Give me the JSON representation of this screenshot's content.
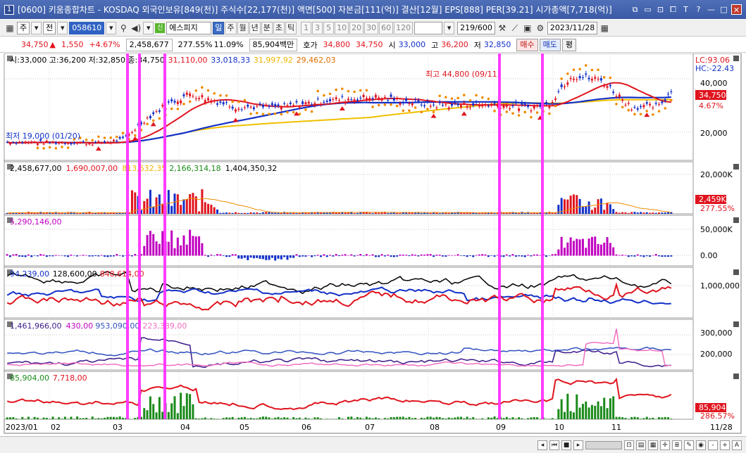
{
  "window": {
    "number": "1",
    "title": "[0600] 키움종합차트 - KOSDAQ 외국인보유[849(천)] 주식수[22,177(천)] 액면[500] 자본금[111(억)] 결산[12월] EPS[888] PER[39.21] 시가총액[7,718(억)]",
    "icons": [
      "link-icon",
      "frame-icon",
      "lock-icon",
      "restore-icon",
      "font-T-icon",
      "help-icon",
      "minimize-icon",
      "maximize-icon",
      "close-icon"
    ],
    "icon_glyphs": [
      "⧉",
      "▭",
      "⊡",
      "⧠",
      "T",
      "?",
      "—",
      "□",
      "✕"
    ]
  },
  "toolbar": {
    "period_sel": "주",
    "prev_btn": "전",
    "code": "058610",
    "stock_name": "에스피지",
    "periods": [
      "일",
      "주",
      "월",
      "년",
      "분",
      "초",
      "틱"
    ],
    "active_period": "일",
    "intervals": [
      "1",
      "3",
      "5",
      "10",
      "20",
      "30",
      "60",
      "120"
    ],
    "count": "219/600",
    "date": "2023/11/28",
    "green_label": "신"
  },
  "quote": {
    "price": "34,750",
    "arrow": "▲",
    "change": "1,550",
    "change_pct": "+4.67%",
    "volume": "2,458,677",
    "vol_ratio": "277.55%",
    "turnover": "11.09%",
    "amount": "85,904백만",
    "hoga_label": "호가",
    "ask": "34,800",
    "bid": "34,750",
    "open_label": "시",
    "open": "33,000",
    "high_label": "고",
    "high": "36,200",
    "low_label": "저",
    "low": "32,850",
    "buy": "매수",
    "sell": "매도",
    "flat": "평"
  },
  "panels": {
    "price": {
      "legend": [
        {
          "text": "시:33,000 고:36,200 저:32,850 종:34,750",
          "color": "#000000"
        },
        {
          "text": "31,110,00",
          "color": "#e0141e"
        },
        {
          "text": "33,018,33",
          "color": "#1230c8"
        },
        {
          "text": "31,997,92",
          "color": "#f0b400"
        },
        {
          "text": "29,462,03",
          "color": "#e07000"
        }
      ],
      "yticks": [
        "40,000",
        "20,000"
      ],
      "lc": "LC:93.06",
      "hc": "HC:-22.43",
      "last_price": "34,750",
      "last_pct": "4.67%",
      "max_label": "최고 44,800 (09/11)",
      "min_label": "최저 19,000 (01/20)"
    },
    "volume": {
      "legend": [
        {
          "text": "2,458,677,00",
          "color": "#000000"
        },
        {
          "text": "1,690,007,00",
          "color": "#e0141e"
        },
        {
          "text": "813,632,35",
          "color": "#f0b400"
        },
        {
          "text": "2,166,314,18",
          "color": "#1a8a1a"
        },
        {
          "text": "1,404,350,32",
          "color": "#000000"
        }
      ],
      "yticks": [
        "20,000K",
        "10,000K"
      ],
      "last_vol": "2,459K",
      "last_pct": "277.55%"
    },
    "osc": {
      "legend": [
        {
          "text": "5,290,146,00",
          "color": "#c000c0"
        }
      ],
      "yticks": [
        "50,000K",
        "0.00"
      ]
    },
    "investor": {
      "legend": [
        {
          "text": "94,239,00",
          "color": "#1230c8"
        },
        {
          "text": "128,600,00",
          "color": "#000000"
        },
        {
          "text": "848,614,00",
          "color": "#e0141e"
        }
      ],
      "yticks": [
        "1,000,000"
      ]
    },
    "program": {
      "legend": [
        {
          "text": "1,461,966,00",
          "color": "#3a1a8a"
        },
        {
          "text": "430,00",
          "color": "#c000c0"
        },
        {
          "text": "953,090,00",
          "color": "#3050c0"
        },
        {
          "text": "223,389,00",
          "color": "#f070c0"
        }
      ],
      "yticks": [
        "300,000",
        "200,000"
      ]
    },
    "amount": {
      "legend": [
        {
          "text": "85,904,00",
          "color": "#1a8a1a"
        },
        {
          "text": "7,718,00",
          "color": "#e0141e"
        }
      ],
      "last_val": "85,904",
      "last_pct": "286.57%"
    }
  },
  "xaxis": [
    "2023/01",
    "02",
    "03",
    "04",
    "05",
    "06",
    "07",
    "08",
    "09",
    "10",
    "11",
    "11/28"
  ],
  "colors": {
    "up": "#e0141e",
    "down": "#1230c8",
    "highlight": "#ff33ff",
    "sar": "#f08c00"
  },
  "bottom": {
    "scale_labels": [
      "-",
      "+",
      "A"
    ]
  }
}
